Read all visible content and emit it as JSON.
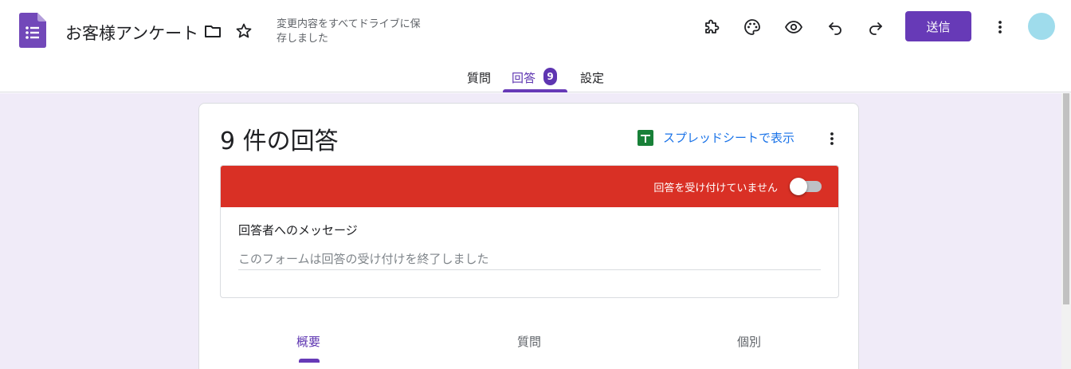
{
  "header": {
    "title": "お客様アンケート",
    "save_status": "変更内容をすべてドライブに保存しました",
    "send_label": "送信"
  },
  "tabs": [
    {
      "label": "質問"
    },
    {
      "label": "回答",
      "badge": "9"
    },
    {
      "label": "設定"
    }
  ],
  "responses": {
    "count_label": "9 件の回答",
    "sheets_link": "スプレッドシートで表示",
    "accepting_label": "回答を受け付けていません",
    "accepting": false,
    "message_label": "回答者へのメッセージ",
    "message_placeholder": "このフォームは回答の受け付けを終了しました"
  },
  "sub_tabs": [
    {
      "label": "概要"
    },
    {
      "label": "質問"
    },
    {
      "label": "個別"
    }
  ],
  "colors": {
    "accent": "#673ab7",
    "banner": "#d93025",
    "background": "#f0ebf8",
    "link": "#1a73e8"
  },
  "icons": [
    "forms-logo",
    "folder-icon",
    "star-icon",
    "addon-icon",
    "palette-icon",
    "preview-eye-icon",
    "undo-icon",
    "redo-icon",
    "more-vert-icon",
    "sheets-icon"
  ]
}
